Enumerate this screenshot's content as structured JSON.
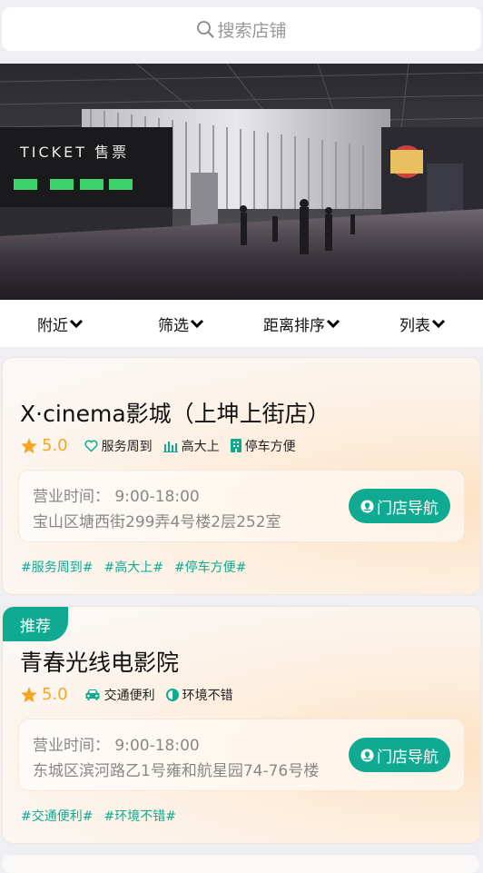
{
  "search": {
    "placeholder": "搜索店铺"
  },
  "banner": {
    "sign_text": "TICKET 售票"
  },
  "filters": [
    {
      "label": "附近"
    },
    {
      "label": "筛选"
    },
    {
      "label": "距离排序"
    },
    {
      "label": "列表"
    }
  ],
  "stores": [
    {
      "badge": "",
      "name": "X·cinema影城（上坤上街店）",
      "rating": "5.0",
      "features": [
        {
          "icon": "heart-icon",
          "label": "服务周到"
        },
        {
          "icon": "bar-chart-icon",
          "label": "高大上"
        },
        {
          "icon": "building-icon",
          "label": "停车方便"
        }
      ],
      "hours": "营业时间：  9:00-18:00",
      "address": "宝山区塘西街299弄4号楼2层252室",
      "nav_label": "门店导航",
      "tags": [
        "#服务周到#",
        "#高大上#",
        "#停车方便#"
      ]
    },
    {
      "badge": "推荐",
      "name": "青春光线电影院",
      "rating": "5.0",
      "features": [
        {
          "icon": "car-icon",
          "label": "交通便利"
        },
        {
          "icon": "half-circle-icon",
          "label": "环境不错"
        }
      ],
      "hours": "营业时间：  9:00-18:00",
      "address": "东城区滨河路乙1号雍和航星园74-76号楼",
      "nav_label": "门店导航",
      "tags": [
        "#交通便利#",
        "#环境不错#"
      ]
    }
  ],
  "colors": {
    "accent": "#10a991",
    "star": "#f5a623"
  }
}
